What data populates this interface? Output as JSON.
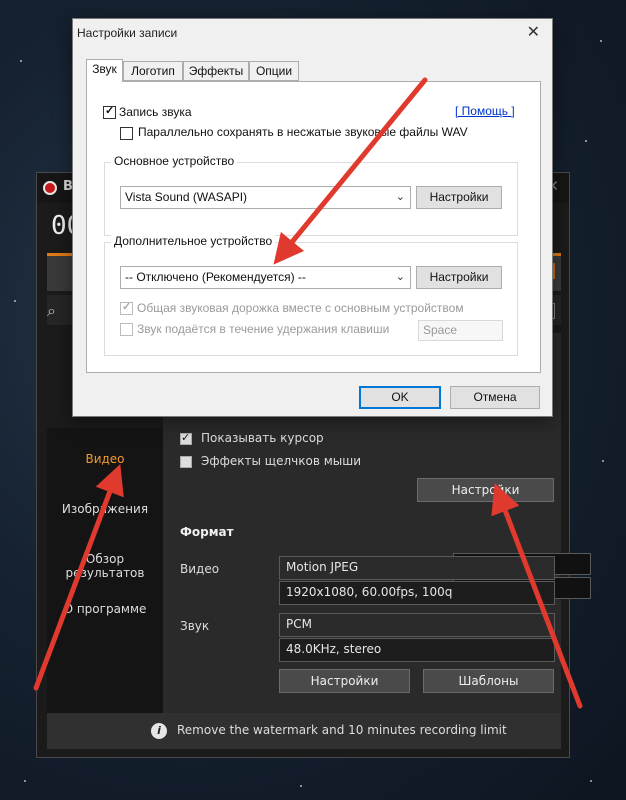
{
  "bandicam": {
    "title_letter": "B",
    "timer": "00",
    "nav": [
      "Видео",
      "Изображения",
      "Обзор результатов",
      "О программе"
    ],
    "show_cursor": "Показывать курсор",
    "click_effects": "Эффекты щелчков мыши",
    "settings_btn": "Настройки",
    "format_header": "Формат",
    "video_label": "Видео",
    "video_codec": "Motion JPEG",
    "video_detail": "1920x1080, 60.00fps, 100q",
    "audio_label": "Звук",
    "audio_codec": "PCM",
    "audio_detail": "48.0KHz, stereo",
    "settings_btn2": "Настройки",
    "templates_btn": "Шаблоны",
    "info_text": "Remove the watermark and 10 minutes recording limit"
  },
  "dialog": {
    "title": "Настройки записи",
    "tabs": [
      "Звук",
      "Логотип",
      "Эффекты",
      "Опции"
    ],
    "record_sound": "Запись звука",
    "help_link": "[ Помощь ]",
    "save_wav": "Параллельно сохранять в несжатые звуковые файлы WAV",
    "primary_group": "Основное устройство",
    "primary_device": "Vista Sound (WASAPI)",
    "primary_settings": "Настройки",
    "secondary_group": "Дополнительное устройство",
    "secondary_device": "-- Отключено (Рекомендуется) --",
    "secondary_settings": "Настройки",
    "mix_track": "Общая звуковая дорожка вместе с основным устройством",
    "hold_key": "Звук подаётся в течение удержания клавиши",
    "hold_key_value": "Space",
    "ok": "OK",
    "cancel": "Отмена"
  },
  "colors": {
    "arrow": "#e03a2e",
    "accent": "#f29a2e"
  }
}
